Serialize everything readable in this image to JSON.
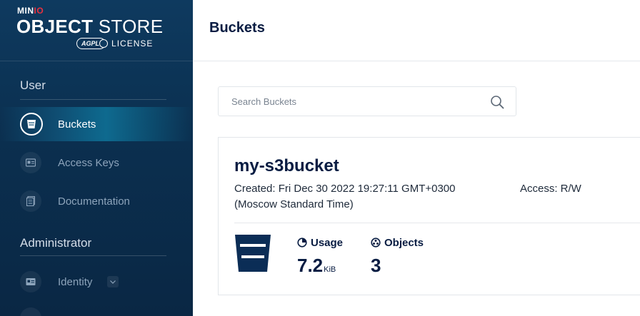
{
  "logo": {
    "brand_prefix": "MIN",
    "brand_suffix": "IO",
    "title_bold": "OBJECT",
    "title_light": " STORE",
    "badge": "AGPL",
    "license": "LICENSE"
  },
  "sidebar": {
    "sections": [
      {
        "label": "User",
        "items": [
          {
            "label": "Buckets",
            "icon": "bucket-icon",
            "active": true
          },
          {
            "label": "Access Keys",
            "icon": "id-card-icon",
            "active": false
          },
          {
            "label": "Documentation",
            "icon": "document-icon",
            "active": false
          }
        ]
      },
      {
        "label": "Administrator",
        "items": [
          {
            "label": "Identity",
            "icon": "identity-icon",
            "active": false,
            "expandable": true
          }
        ]
      }
    ]
  },
  "header": {
    "title": "Buckets"
  },
  "search": {
    "placeholder": "Search Buckets",
    "value": ""
  },
  "buckets": [
    {
      "name": "my-s3bucket",
      "created": "Created: Fri Dec 30 2022 19:27:11 GMT+0300 (Moscow Standard Time)",
      "access": "Access: R/W",
      "usage_label": "Usage",
      "usage_value": "7.2",
      "usage_unit": "KiB",
      "objects_label": "Objects",
      "objects_value": "3"
    }
  ],
  "colors": {
    "sidebar_bg": "#0b2f4f",
    "accent": "#0e6a8f",
    "text_dark": "#081c42",
    "brand_red": "#e8313f"
  }
}
